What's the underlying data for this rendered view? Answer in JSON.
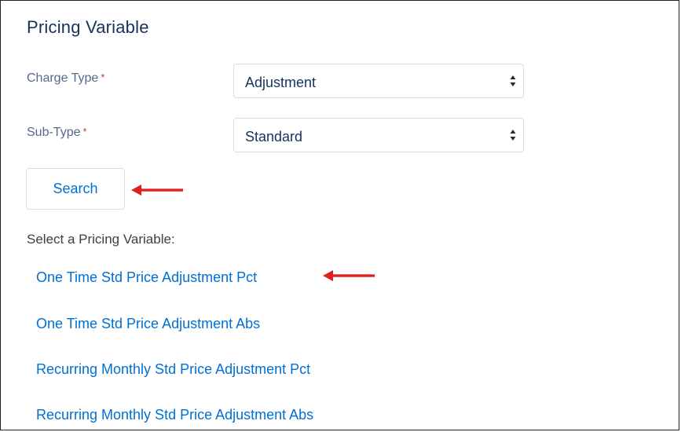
{
  "panel": {
    "title": "Pricing Variable"
  },
  "form": {
    "charge_type": {
      "label": "Charge Type",
      "required_mark": "*",
      "value": "Adjustment"
    },
    "sub_type": {
      "label": "Sub-Type",
      "required_mark": "*",
      "value": "Standard"
    },
    "search_label": "Search"
  },
  "results": {
    "label": "Select a Pricing Variable:",
    "items": [
      "One Time Std Price Adjustment Pct",
      "One Time Std Price Adjustment Abs",
      "Recurring Monthly Std Price Adjustment Pct",
      "Recurring Monthly Std Price Adjustment Abs"
    ]
  },
  "colors": {
    "link": "#0070d2",
    "title": "#16325c",
    "required": "#c23934",
    "annotation_arrow": "#e02020"
  },
  "icons": {
    "select_arrows": "sort-updown-icon",
    "annotation": "red-arrow-left-icon"
  }
}
